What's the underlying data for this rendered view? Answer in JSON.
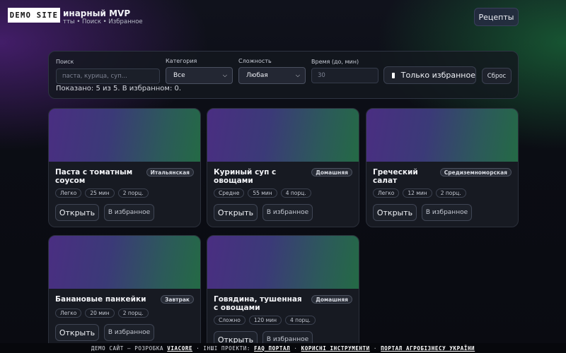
{
  "header": {
    "badge": "DEMO SITE",
    "title": "инарный MVP",
    "subtitle": "тты • Поиск • Избранное",
    "nav_button": "Рецепты"
  },
  "filters": {
    "search_label": "Поиск",
    "search_placeholder": "паста, курица, суп...",
    "category_label": "Категория",
    "category_value": "Все",
    "difficulty_label": "Сложность",
    "difficulty_value": "Любая",
    "time_label": "Время (до, мин)",
    "time_placeholder": "30",
    "favorites_only_label": "Только избранное",
    "reset_label": "Сброс",
    "status_text": "Показано: 5 из 5. В избранном: 0."
  },
  "card_actions": {
    "open_label": "Открыть",
    "favorite_label": "В избранное"
  },
  "recipes": [
    {
      "title": "Паста с томатным соусом",
      "cuisine": "Итальянская",
      "difficulty": "Легко",
      "time": "25 мин",
      "servings": "2 порц."
    },
    {
      "title": "Куриный суп с овощами",
      "cuisine": "Домашняя",
      "difficulty": "Средне",
      "time": "55 мин",
      "servings": "4 порц."
    },
    {
      "title": "Греческий салат",
      "cuisine": "Средиземноморская",
      "difficulty": "Легко",
      "time": "12 мин",
      "servings": "2 порц."
    },
    {
      "title": "Банановые панкейки",
      "cuisine": "Завтрак",
      "difficulty": "Легко",
      "time": "20 мин",
      "servings": "2 порц."
    },
    {
      "title": "Говядина, тушенная с овощами",
      "cuisine": "Домашняя",
      "difficulty": "Сложно",
      "time": "120 мин",
      "servings": "4 порц."
    }
  ],
  "footer": {
    "prefix": "ДЕМО САЙТ — РОЗРОБКА",
    "dev_link": "VIACORE",
    "sep1": "· ІНШІ ПРОЕКТИ:",
    "link1": "FAQ ПОРТАЛ",
    "sep2": "·",
    "link2": "КОРИСНІ ІНСТРУМЕНТИ",
    "sep3": "·",
    "link3": "ПОРТАЛ АГРОБІЗНЕСУ УКРАЇНИ"
  },
  "colors": {
    "background": "#0b0d14",
    "accent_purple": "#6e28aa",
    "accent_green": "#1e8c46",
    "card": "#171a22"
  }
}
